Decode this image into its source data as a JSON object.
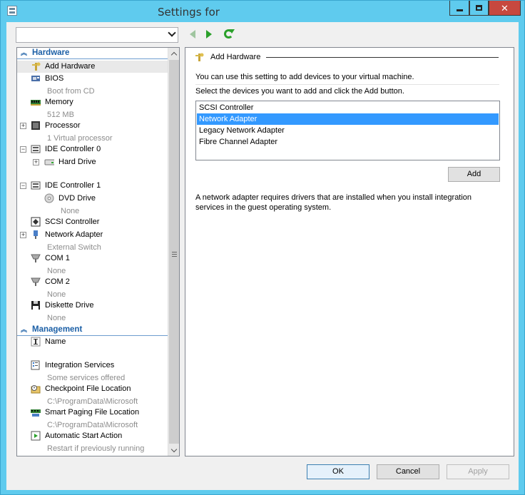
{
  "window": {
    "title": "Settings for",
    "min_label": "",
    "close_glyph": "✕"
  },
  "vm_select": {
    "value": ""
  },
  "sidebar": {
    "hardware_header": "Hardware",
    "management_header": "Management",
    "items": [
      {
        "label": "Add Hardware",
        "sub": ""
      },
      {
        "label": "BIOS",
        "sub": "Boot from CD"
      },
      {
        "label": "Memory",
        "sub": "512 MB"
      },
      {
        "label": "Processor",
        "sub": "1 Virtual processor"
      },
      {
        "label": "IDE Controller 0",
        "sub": ""
      },
      {
        "label": "Hard Drive",
        "sub": ""
      },
      {
        "label": "IDE Controller 1",
        "sub": ""
      },
      {
        "label": "DVD Drive",
        "sub": "None"
      },
      {
        "label": "SCSI Controller",
        "sub": ""
      },
      {
        "label": "Network Adapter",
        "sub": "External Switch"
      },
      {
        "label": "COM 1",
        "sub": "None"
      },
      {
        "label": "COM 2",
        "sub": "None"
      },
      {
        "label": "Diskette Drive",
        "sub": "None"
      },
      {
        "label": "Name",
        "sub": ""
      },
      {
        "label": "Integration Services",
        "sub": "Some services offered"
      },
      {
        "label": "Checkpoint File Location",
        "sub": "C:\\ProgramData\\Microsoft"
      },
      {
        "label": "Smart Paging File Location",
        "sub": "C:\\ProgramData\\Microsoft"
      },
      {
        "label": "Automatic Start Action",
        "sub": "Restart if previously running"
      }
    ]
  },
  "main": {
    "title": "Add Hardware",
    "intro": "You can use this setting to add devices to your virtual machine.",
    "instruction": "Select the devices you want to add and click the Add button.",
    "devices": [
      "SCSI Controller",
      "Network Adapter",
      "Legacy Network Adapter",
      "Fibre Channel Adapter"
    ],
    "selected_device": "Network Adapter",
    "add_button": "Add",
    "note": "A network adapter requires drivers that are installed when you install integration services in the guest operating system."
  },
  "footer": {
    "ok": "OK",
    "cancel": "Cancel",
    "apply": "Apply"
  },
  "colors": {
    "titlebar": "#5fcbee",
    "close": "#c7483f",
    "selection": "#3399ff",
    "section_header": "#1b5fa6"
  }
}
